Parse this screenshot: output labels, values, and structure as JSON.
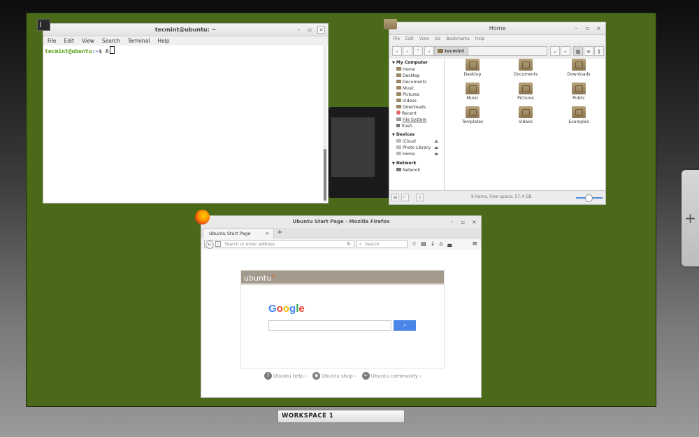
{
  "terminal": {
    "title": "tecmint@ubuntu: ~",
    "menu": [
      "File",
      "Edit",
      "View",
      "Search",
      "Terminal",
      "Help"
    ],
    "prompt_user": "tecmint@ubuntu",
    "prompt_path": ":~",
    "prompt_symbol": "$ ",
    "command": "A"
  },
  "files": {
    "title": "Home",
    "menu": [
      "File",
      "Edit",
      "View",
      "Go",
      "Bookmarks",
      "Help"
    ],
    "path_crumb": "tecmint",
    "sections": {
      "my_computer": "My Computer",
      "devices": "Devices",
      "network": "Network"
    },
    "places": [
      "Home",
      "Desktop",
      "Documents",
      "Music",
      "Pictures",
      "Videos",
      "Downloads",
      "Recent",
      "File System",
      "Trash"
    ],
    "devices": [
      "iCloud",
      "Photo Library",
      "Home"
    ],
    "network": [
      "Network"
    ],
    "folders": [
      "Desktop",
      "Documents",
      "Downloads",
      "Music",
      "Pictures",
      "Public",
      "Templates",
      "Videos",
      "Examples"
    ],
    "status": "9 items, Free space: 57.4 GB"
  },
  "firefox": {
    "title": "Ubuntu Start Page - Mozilla Firefox",
    "tab_label": "Ubuntu Start Page",
    "url_placeholder": "Search or enter address",
    "search_placeholder": "Search",
    "page": {
      "brand": "ubuntu",
      "google_letters": [
        "G",
        "o",
        "o",
        "g",
        "l",
        "e"
      ],
      "links": [
        "Ubuntu help ›",
        "Ubuntu shop ›",
        "Ubuntu community ›"
      ]
    }
  },
  "workspace": {
    "label": "WORKSPACE 1",
    "add_symbol": "+"
  }
}
